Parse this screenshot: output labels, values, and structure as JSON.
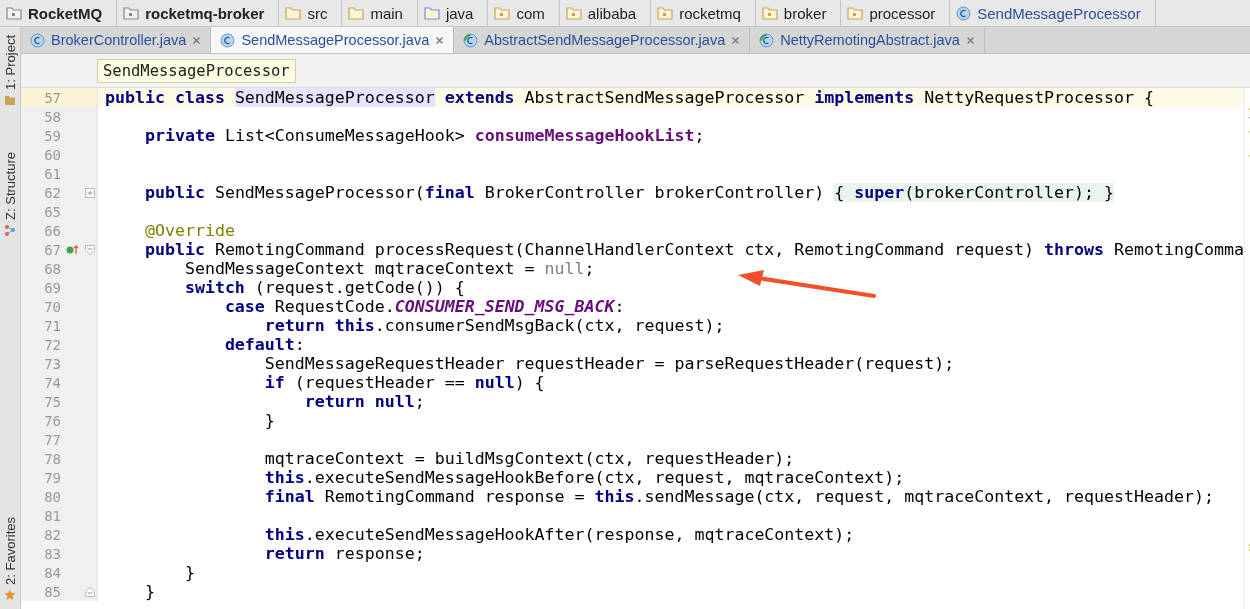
{
  "breadcrumbs": [
    {
      "label": "RocketMQ",
      "kind": "project"
    },
    {
      "label": "rocketmq-broker",
      "kind": "module"
    },
    {
      "label": "src",
      "kind": "folder"
    },
    {
      "label": "main",
      "kind": "folder"
    },
    {
      "label": "java",
      "kind": "source"
    },
    {
      "label": "com",
      "kind": "package"
    },
    {
      "label": "alibaba",
      "kind": "package"
    },
    {
      "label": "rocketmq",
      "kind": "package"
    },
    {
      "label": "broker",
      "kind": "package"
    },
    {
      "label": "processor",
      "kind": "package"
    },
    {
      "label": "SendMessageProcessor",
      "kind": "class"
    }
  ],
  "tool_windows": [
    {
      "label": "1: Project",
      "kind": "project"
    },
    {
      "label": "Z: Structure",
      "kind": "structure"
    },
    {
      "label": "2: Favorites",
      "kind": "favorites"
    }
  ],
  "tabs": [
    {
      "label": "BrokerController.java",
      "kind": "class",
      "selected": false
    },
    {
      "label": "SendMessageProcessor.java",
      "kind": "class",
      "selected": true
    },
    {
      "label": "AbstractSendMessageProcessor.java",
      "kind": "abstract",
      "selected": false
    },
    {
      "label": "NettyRemotingAbstract.java",
      "kind": "abstract",
      "selected": false
    }
  ],
  "header_tooltip": "SendMessageProcessor",
  "lines": [
    {
      "number": "57",
      "current": true,
      "kind": "plain",
      "tokens": [
        {
          "kind": "keyword",
          "text": "public class "
        },
        {
          "kind": "usage",
          "text": "SendMessageProcessor"
        },
        {
          "kind": "keyword",
          "text": " extends"
        },
        {
          "kind": "plain",
          "text": " AbstractSendMessageProcessor "
        },
        {
          "kind": "keyword",
          "text": "implements"
        },
        {
          "kind": "plain",
          "text": " NettyRequestProcessor {"
        }
      ]
    },
    {
      "number": "58",
      "current": false,
      "kind": "plain"
    },
    {
      "number": "59",
      "current": false,
      "kind": "plain",
      "tokens": [
        {
          "kind": "keyword",
          "text": "    private"
        },
        {
          "kind": "plain",
          "text": " List<ConsumeMessageHook> "
        },
        {
          "kind": "field",
          "text": "consumeMessageHookList"
        },
        {
          "kind": "plain",
          "text": ";"
        }
      ]
    },
    {
      "number": "60",
      "current": false,
      "kind": "plain"
    },
    {
      "number": "61",
      "current": false,
      "kind": "plain"
    },
    {
      "number": "62",
      "current": false,
      "kind": "folded",
      "tokens": [
        {
          "kind": "keyword",
          "text": "    public"
        },
        {
          "kind": "plain",
          "text": " SendMessageProcessor("
        },
        {
          "kind": "keyword",
          "text": "final"
        },
        {
          "kind": "plain",
          "text": " BrokerController brokerController) "
        },
        {
          "kind": "fold",
          "text": "{ "
        },
        {
          "kind": "foldkw",
          "text": "super"
        },
        {
          "kind": "fold",
          "text": "(brokerController); }"
        }
      ]
    },
    {
      "number": "65",
      "current": false,
      "kind": "plain"
    },
    {
      "number": "66",
      "current": false,
      "kind": "plain",
      "tokens": [
        {
          "kind": "annotation",
          "text": "    @Override"
        }
      ]
    },
    {
      "number": "67",
      "current": false,
      "kind": "override",
      "tokens": [
        {
          "kind": "keyword",
          "text": "    public"
        },
        {
          "kind": "plain",
          "text": " RemotingCommand processRequest(ChannelHandlerContext ctx, RemotingCommand request) "
        },
        {
          "kind": "keyword",
          "text": "throws"
        },
        {
          "kind": "plain",
          "text": " RemotingComma"
        }
      ]
    },
    {
      "number": "68",
      "current": false,
      "kind": "plain",
      "tokens": [
        {
          "kind": "plain",
          "text": "        SendMessageContext mqtraceContext = "
        },
        {
          "kind": "redundant",
          "text": "null"
        },
        {
          "kind": "plain",
          "text": ";"
        }
      ]
    },
    {
      "number": "69",
      "current": false,
      "kind": "plain",
      "tokens": [
        {
          "kind": "keyword",
          "text": "        switch"
        },
        {
          "kind": "plain",
          "text": " (request.getCode()) {"
        }
      ]
    },
    {
      "number": "70",
      "current": false,
      "kind": "plain",
      "tokens": [
        {
          "kind": "keyword",
          "text": "            case"
        },
        {
          "kind": "plain",
          "text": " RequestCode."
        },
        {
          "kind": "constant",
          "text": "CONSUMER_SEND_MSG_BACK"
        },
        {
          "kind": "plain",
          "text": ":"
        }
      ]
    },
    {
      "number": "71",
      "current": false,
      "kind": "plain",
      "tokens": [
        {
          "kind": "keyword",
          "text": "                return this"
        },
        {
          "kind": "plain",
          "text": ".consumerSendMsgBack(ctx, request);"
        }
      ]
    },
    {
      "number": "72",
      "current": false,
      "kind": "plain",
      "tokens": [
        {
          "kind": "keyword",
          "text": "            default"
        },
        {
          "kind": "plain",
          "text": ":"
        }
      ]
    },
    {
      "number": "73",
      "current": false,
      "kind": "plain",
      "tokens": [
        {
          "kind": "plain",
          "text": "                SendMessageRequestHeader requestHeader = parseRequestHeader(request);"
        }
      ]
    },
    {
      "number": "74",
      "current": false,
      "kind": "plain",
      "tokens": [
        {
          "kind": "keyword",
          "text": "                if"
        },
        {
          "kind": "plain",
          "text": " (requestHeader == "
        },
        {
          "kind": "keyword",
          "text": "null"
        },
        {
          "kind": "plain",
          "text": ") {"
        }
      ]
    },
    {
      "number": "75",
      "current": false,
      "kind": "plain",
      "tokens": [
        {
          "kind": "keyword",
          "text": "                    return null"
        },
        {
          "kind": "plain",
          "text": ";"
        }
      ]
    },
    {
      "number": "76",
      "current": false,
      "kind": "plain",
      "tokens": [
        {
          "kind": "plain",
          "text": "                }"
        }
      ]
    },
    {
      "number": "77",
      "current": false,
      "kind": "plain"
    },
    {
      "number": "78",
      "current": false,
      "kind": "plain",
      "tokens": [
        {
          "kind": "plain",
          "text": "                mqtraceContext = buildMsgContext(ctx, requestHeader);"
        }
      ]
    },
    {
      "number": "79",
      "current": false,
      "kind": "plain",
      "tokens": [
        {
          "kind": "keyword",
          "text": "                this"
        },
        {
          "kind": "plain",
          "text": ".executeSendMessageHookBefore(ctx, request, mqtraceContext);"
        }
      ]
    },
    {
      "number": "80",
      "current": false,
      "kind": "plain",
      "tokens": [
        {
          "kind": "keyword",
          "text": "                final"
        },
        {
          "kind": "plain",
          "text": " RemotingCommand response = "
        },
        {
          "kind": "keyword",
          "text": "this"
        },
        {
          "kind": "plain",
          "text": ".sendMessage(ctx, request, mqtraceContext, requestHeader);"
        }
      ]
    },
    {
      "number": "81",
      "current": false,
      "kind": "plain"
    },
    {
      "number": "82",
      "current": false,
      "kind": "plain",
      "tokens": [
        {
          "kind": "keyword",
          "text": "                this"
        },
        {
          "kind": "plain",
          "text": ".executeSendMessageHookAfter(response, mqtraceContext);"
        }
      ]
    },
    {
      "number": "83",
      "current": false,
      "kind": "plain",
      "tokens": [
        {
          "kind": "keyword",
          "text": "                return"
        },
        {
          "kind": "plain",
          "text": " response;"
        }
      ]
    },
    {
      "number": "84",
      "current": false,
      "kind": "plain",
      "tokens": [
        {
          "kind": "plain",
          "text": "        }"
        }
      ]
    },
    {
      "number": "85",
      "current": false,
      "kind": "fold_end",
      "tokens": [
        {
          "kind": "plain",
          "text": "    }"
        }
      ]
    }
  ]
}
